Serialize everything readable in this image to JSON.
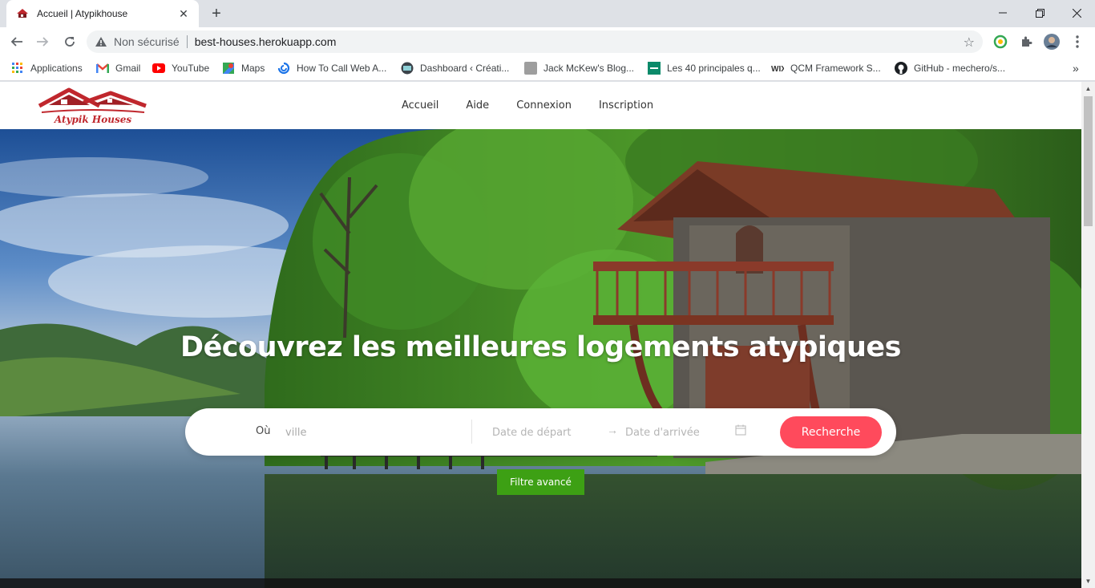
{
  "browser": {
    "tab_title": "Accueil | Atypikhouse",
    "security_label": "Non sécurisé",
    "url": "best-houses.herokuapp.com",
    "bookmarks": [
      {
        "label": "Applications",
        "icon": "apps-grid-icon"
      },
      {
        "label": "Gmail",
        "icon": "gmail-icon"
      },
      {
        "label": "YouTube",
        "icon": "youtube-icon"
      },
      {
        "label": "Maps",
        "icon": "maps-icon"
      },
      {
        "label": "How To Call Web A...",
        "icon": "swirl-icon"
      },
      {
        "label": "Dashboard ‹ Créati...",
        "icon": "dashboard-icon"
      },
      {
        "label": "Jack McKew's Blog...",
        "icon": "blog-icon"
      },
      {
        "label": "Les 40 principales q...",
        "icon": "list-icon"
      },
      {
        "label": "QCM Framework S...",
        "icon": "wix-icon"
      },
      {
        "label": "GitHub - mechero/s...",
        "icon": "github-icon"
      }
    ],
    "more_bookmarks": "»"
  },
  "site": {
    "logo_text": "Atypik Houses",
    "nav": [
      "Accueil",
      "Aide",
      "Connexion",
      "Inscription"
    ]
  },
  "hero": {
    "headline": "Découvrez les meilleures logements atypiques",
    "search": {
      "where_label": "Où",
      "where_placeholder": "ville",
      "start_placeholder": "Date de départ",
      "arrow": "→",
      "end_placeholder": "Date d'arrivée",
      "button": "Recherche"
    },
    "filter_button": "Filtre avancé"
  },
  "colors": {
    "search_button": "#ff4a5c",
    "filter_button": "#3da014",
    "logo_red": "#c0272d"
  }
}
